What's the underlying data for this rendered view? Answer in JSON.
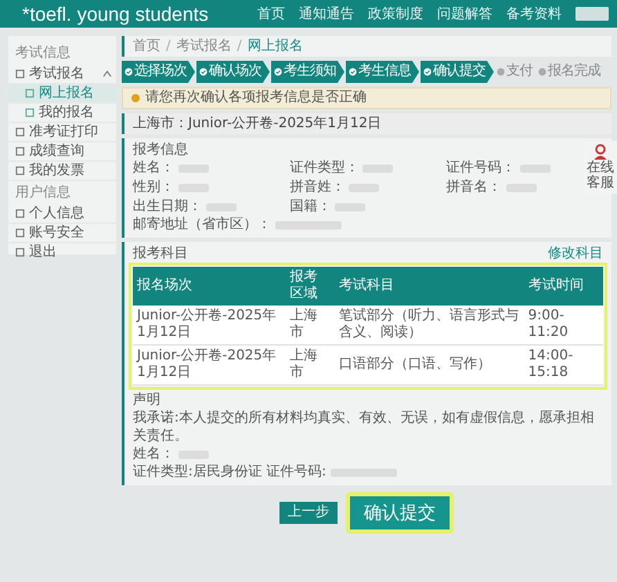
{
  "header": {
    "logo": "*toefl. young students",
    "nav": [
      {
        "label": "首页"
      },
      {
        "label": "通知通告"
      },
      {
        "label": "政策制度"
      },
      {
        "label": "问题解答"
      },
      {
        "label": "备考资料"
      }
    ]
  },
  "sidebar": {
    "sections": [
      {
        "title": "考试信息",
        "items": [
          {
            "label": "考试报名",
            "selected": false,
            "expanded": true,
            "children": [
              {
                "label": "网上报名",
                "selected": true
              },
              {
                "label": "我的报名",
                "selected": false
              }
            ]
          },
          {
            "label": "准考证打印",
            "selected": false
          },
          {
            "label": "成绩查询",
            "selected": false
          },
          {
            "label": "我的发票",
            "selected": false
          }
        ]
      },
      {
        "title": "用户信息",
        "items": [
          {
            "label": "个人信息",
            "selected": false
          },
          {
            "label": "账号安全",
            "selected": false
          },
          {
            "label": "退出",
            "selected": false
          }
        ]
      }
    ]
  },
  "breadcrumb_separator": "/",
  "breadcrumb": [
    {
      "label": "首页",
      "selected": false
    },
    {
      "label": "考试报名",
      "selected": false
    },
    {
      "label": "网上报名",
      "selected": true
    }
  ],
  "steps": [
    {
      "label": "选择场次",
      "done": true
    },
    {
      "label": "确认场次",
      "done": true
    },
    {
      "label": "考生须知",
      "done": true
    },
    {
      "label": "考生信息",
      "done": true
    },
    {
      "label": "确认提交",
      "done": true
    },
    {
      "label": "支付",
      "done": false
    },
    {
      "label": "报名完成",
      "done": false
    }
  ],
  "alert": "请您再次确认各项报考信息是否正确",
  "session": "上海市：Junior-公开卷-2025年1月12日",
  "info": {
    "title": "报考信息",
    "fields": [
      {
        "label": "姓名："
      },
      {
        "label": "证件类型："
      },
      {
        "label": "证件号码："
      },
      {
        "label": "性别："
      },
      {
        "label": "拼音姓："
      },
      {
        "label": "拼音名："
      },
      {
        "label": "出生日期："
      },
      {
        "label": "国籍："
      }
    ],
    "address_label": "邮寄地址（省市区）："
  },
  "subjects": {
    "title": "报考科目",
    "edit_link": "修改科目",
    "columns": [
      "报名场次",
      "报考区域",
      "考试科目",
      "考试时间"
    ],
    "rows": [
      [
        "Junior-公开卷-2025年1月12日",
        "上海市",
        "笔试部分（听力、语言形式与含义、阅读）",
        "9:00-11:20"
      ],
      [
        "Junior-公开卷-2025年1月12日",
        "上海市",
        "口语部分（口语、写作）",
        "14:00-15:18"
      ]
    ]
  },
  "declaration": {
    "title": "声明",
    "text": "我承诺:本人提交的所有材料均真实、有效、无误，如有虚假信息，愿承担相关责任。",
    "name_label": "姓名：",
    "id_label": "证件类型:居民身份证 证件号码:"
  },
  "buttons": {
    "prev": "上一步",
    "submit": "确认提交"
  },
  "service": {
    "label": "在线客服"
  }
}
